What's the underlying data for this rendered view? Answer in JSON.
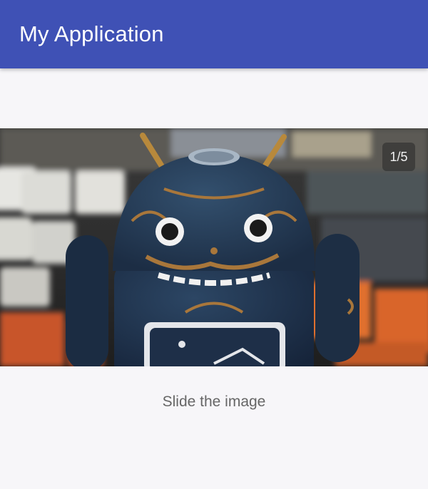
{
  "app_bar": {
    "title": "My Application",
    "color": "#3f51b5"
  },
  "slider": {
    "current_page": 1,
    "page_count": 5,
    "indicator": "1/5",
    "image": "android-figure-photo"
  },
  "caption": "Slide the image"
}
